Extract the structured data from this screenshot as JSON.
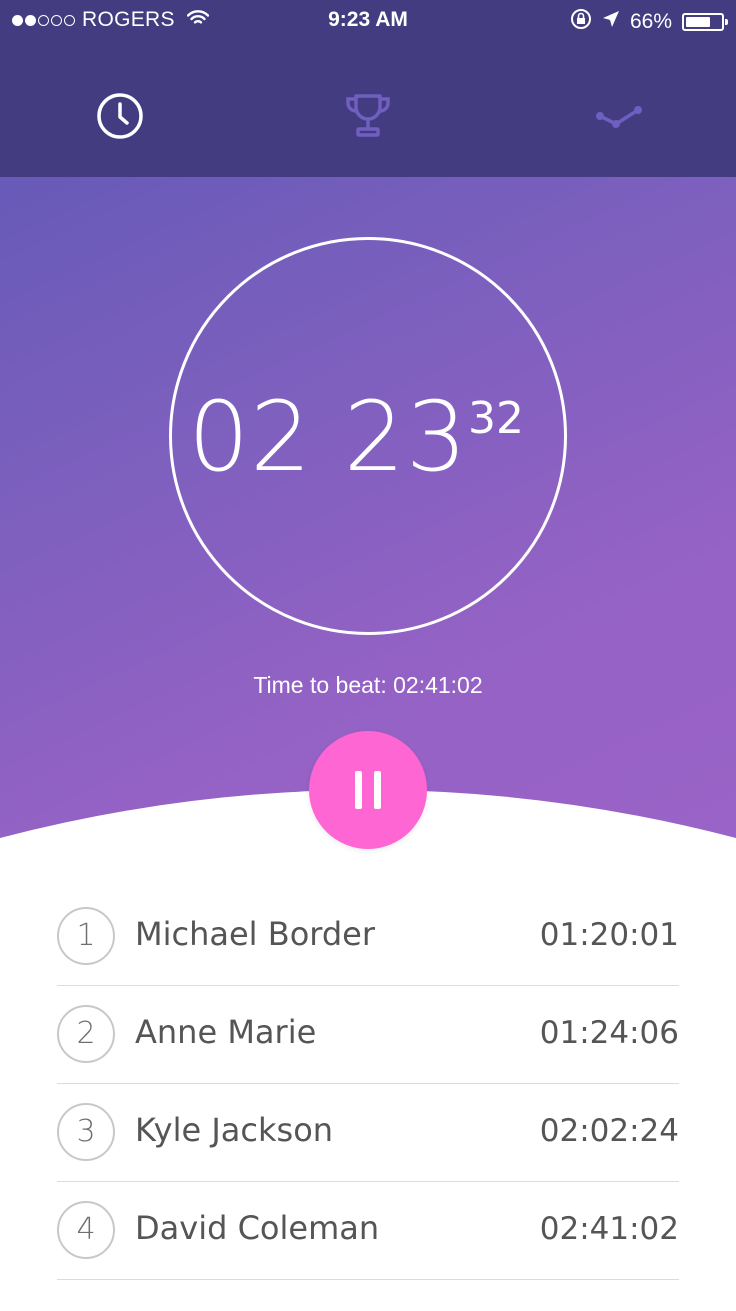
{
  "status_bar": {
    "carrier": "ROGERS",
    "signal_bars_filled": 2,
    "signal_bars_total": 5,
    "time": "9:23 AM",
    "battery": "66%"
  },
  "tabs": [
    {
      "icon": "clock-icon",
      "active": true
    },
    {
      "icon": "trophy-icon",
      "active": false
    },
    {
      "icon": "stats-icon",
      "active": false
    }
  ],
  "timer": {
    "minutes": "02",
    "seconds": "23",
    "fraction": "32"
  },
  "time_to_beat": "Time to beat: 02:41:02",
  "leaderboard": [
    {
      "rank": "1",
      "name": "Michael Border",
      "time": "01:20:01"
    },
    {
      "rank": "2",
      "name": "Anne Marie",
      "time": "01:24:06"
    },
    {
      "rank": "3",
      "name": "Kyle Jackson",
      "time": "02:02:24"
    },
    {
      "rank": "4",
      "name": "David Coleman",
      "time": "02:41:02"
    }
  ],
  "colors": {
    "header": "#433c80",
    "gradient_start": "#5c57b5",
    "gradient_end": "#9a63c7",
    "accent": "#fe66d4",
    "inactive_icon": "#6f5fc0"
  }
}
